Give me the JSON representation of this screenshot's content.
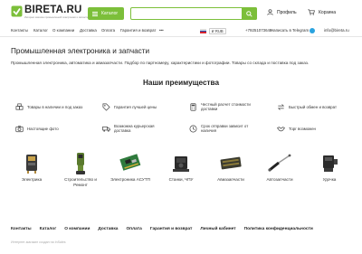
{
  "brand": {
    "name": "BIRETA.RU",
    "tagline": "Интернет-магазин промышленной электроники и запчастей",
    "accent": "#7cbf3a"
  },
  "header": {
    "catalog_label": "Каталог",
    "search_placeholder": "",
    "profile_label": "Профиль",
    "cart_label": "Корзина"
  },
  "nav": {
    "items": [
      "Контакты",
      "Каталог",
      "О компании",
      "Доставка",
      "Оплата",
      "Гарантия и возврат",
      "•••"
    ],
    "language": "RU",
    "currency": "₽ RUB",
    "phone": "+79251073648",
    "telegram": "Написать в Telegram",
    "email": "info@bireta.ru"
  },
  "main": {
    "title": "Промышленная электроника и запчасти",
    "description": "Промышленная электроника, автоматика и авиазапчасти. Подбор по партномеру, характеристики и фотографии. Товары со склада и поставка под заказ.",
    "advantages_title": "Наши преимущества",
    "advantages": [
      {
        "label": "Товары в наличии и под заказ",
        "icon": "boxes-icon"
      },
      {
        "label": "Гарантия лучшей цены",
        "icon": "price-tag-icon"
      },
      {
        "label": "Честный расчет стоимости доставки",
        "icon": "calculator-icon"
      },
      {
        "label": "Быстрый обмен и возврат",
        "icon": "exchange-icon"
      },
      {
        "label": "Настоящие фото",
        "icon": "camera-icon"
      },
      {
        "label": "Возможна курьерская доставка",
        "icon": "courier-icon"
      },
      {
        "label": "Срок отправки зависит от наличия",
        "icon": "clock-icon"
      },
      {
        "label": "Торг возможен",
        "icon": "handshake-icon"
      }
    ],
    "categories": [
      {
        "label": "Электрика",
        "icon": "electrical-relay-icon"
      },
      {
        "label": "Строительство и Ремонт",
        "icon": "power-tool-icon"
      },
      {
        "label": "Электроника АСУТП",
        "icon": "circuit-board-icon"
      },
      {
        "label": "Станки, ЧПУ",
        "icon": "cnc-machine-icon"
      },
      {
        "label": "Авиазапчасти",
        "icon": "aviation-part-icon"
      },
      {
        "label": "Автозапчасти",
        "icon": "gas-strut-icon"
      },
      {
        "label": "Удочка",
        "icon": "fishing-reel-icon"
      }
    ]
  },
  "footer": {
    "links": [
      "Контакты",
      "Каталог",
      "О компании",
      "Доставка",
      "Оплата",
      "Гарантия и возврат",
      "Личный кабинет",
      "Политика конфиденциальности"
    ],
    "note": "Интернет-магазин создан на InSales"
  }
}
